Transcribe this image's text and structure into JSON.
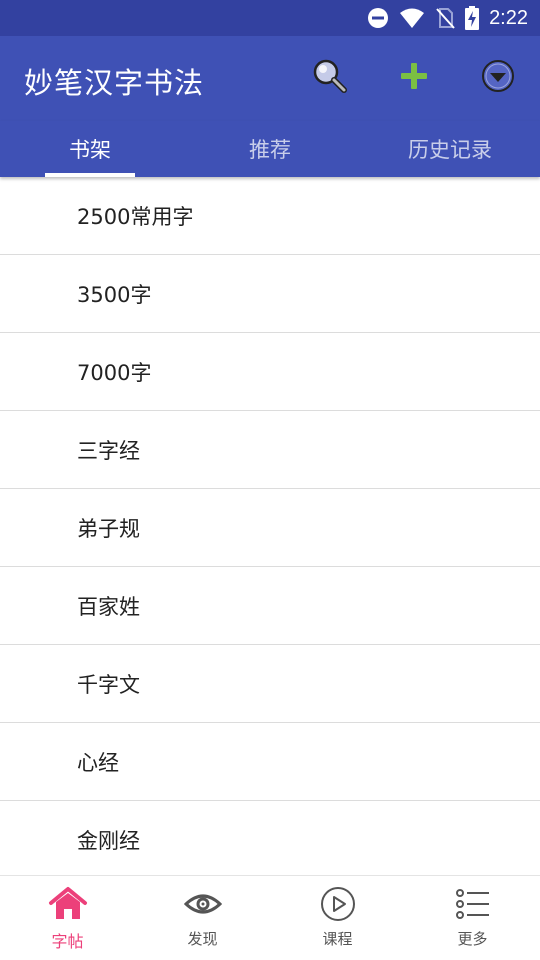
{
  "status_bar": {
    "time": "2:22",
    "icons": [
      "do-not-disturb-icon",
      "wifi-icon",
      "no-sim-icon",
      "battery-charging-icon"
    ]
  },
  "app_bar": {
    "title": "妙笔汉字书法",
    "actions": [
      "search-icon",
      "add-icon",
      "dropdown-menu-icon"
    ],
    "accent_add": "#7bc043"
  },
  "tabs": [
    {
      "label": "书架",
      "active": true
    },
    {
      "label": "推荐",
      "active": false
    },
    {
      "label": "历史记录",
      "active": false
    }
  ],
  "books": [
    {
      "label": "2500常用字"
    },
    {
      "label": "3500字"
    },
    {
      "label": "7000字"
    },
    {
      "label": "三字经"
    },
    {
      "label": "弟子规"
    },
    {
      "label": "百家姓"
    },
    {
      "label": "千字文"
    },
    {
      "label": "心经"
    },
    {
      "label": "金刚经"
    }
  ],
  "bottom_nav": [
    {
      "label": "字帖",
      "icon": "home-icon",
      "active": true
    },
    {
      "label": "发现",
      "icon": "eye-icon",
      "active": false
    },
    {
      "label": "课程",
      "icon": "play-circle-icon",
      "active": false
    },
    {
      "label": "更多",
      "icon": "list-icon",
      "active": false
    }
  ],
  "colors": {
    "status_bar": "#3341a0",
    "primary": "#3f51b5",
    "accent_pink": "#ec407a"
  }
}
